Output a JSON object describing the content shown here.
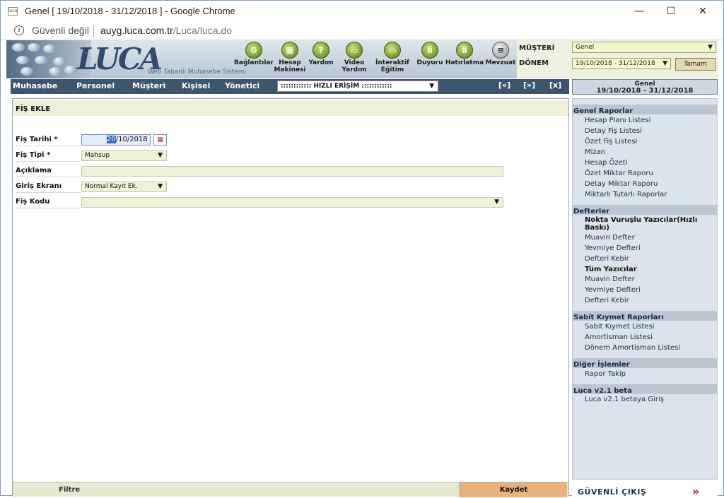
{
  "window": {
    "title": "Genel [ 19/10/2018 - 31/12/2018 ] - Google Chrome",
    "favicon": "luca",
    "minimize": "—",
    "maximize": "☐",
    "close": "✕"
  },
  "address": {
    "security": "Güvenli değil",
    "url_domain": "auyg.luca.com.tr",
    "url_path": "/Luca/luca.do",
    "info_icon": "i"
  },
  "banner": {
    "logo": "LUCA",
    "tagline": "Web Tabanlı Muhasebe Sistemi",
    "tools": [
      {
        "label1": "Bağlantılar",
        "label2": ""
      },
      {
        "label1": "Hesap",
        "label2": "Makinesi"
      },
      {
        "label1": "Yardım",
        "label2": ""
      },
      {
        "label1": "Video",
        "label2": "Yardım"
      },
      {
        "label1": "İnteraktif",
        "label2": "Eğitim"
      },
      {
        "label1": "Duyuru",
        "label2": ""
      },
      {
        "label1": "Hatırlatma",
        "label2": ""
      },
      {
        "label1": "Mevzuat",
        "label2": ""
      }
    ]
  },
  "top": {
    "musteri_label": "MÜŞTERİ",
    "musteri_value": "Genel",
    "donem_label": "DÖNEM",
    "donem_value": "19/10/2018 - 31/12/2018",
    "ok_button": "Tamam"
  },
  "menu": {
    "items": [
      "Muhasebe",
      "Personel",
      "Müşteri",
      "Kişisel",
      "Yönetici"
    ],
    "quick_access": ":::::::::::: HIZLI ERİŞİM ::::::::::::",
    "nav": [
      "[«]",
      "[»]",
      "[x]"
    ]
  },
  "period": {
    "label": "Genel",
    "dates": "19/10/2018 - 31/12/2018"
  },
  "form": {
    "title": "FİŞ EKLE",
    "fis_tarihi_label": "Fiş Tarihi *",
    "date_selected": "20",
    "date_rest": "/10/2018",
    "fis_tipi_label": "Fiş Tipi *",
    "fis_tipi_value": "Mahsup",
    "aciklama_label": "Açıklama",
    "aciklama_value": "",
    "giris_label": "Giriş Ekranı",
    "giris_value": "Normal Kayıt Ek.",
    "fis_kodu_label": "Fiş Kodu",
    "fis_kodu_value": "",
    "filtre": "Filtre",
    "kaydet": "Kaydet"
  },
  "sidebar": {
    "genel_raporlar": {
      "title": "Genel Raporlar",
      "items": [
        "Hesap Planı Listesi",
        "Detay Fiş Listesi",
        "Özet Fiş Listesi",
        "Mizan",
        "Hesap Özeti",
        "Özet Miktar Raporu",
        "Detay Miktar Raporu",
        "Miktarlı Tutarlı Raporlar"
      ]
    },
    "defterler": {
      "title": "Defterler",
      "sub1": "Nokta Vuruşlu Yazıcılar(Hızlı Baskı)",
      "items1": [
        "Muavin Defter",
        "Yevmiye Defteri",
        "Defteri Kebir"
      ],
      "sub2": "Tüm Yazıcılar",
      "items2": [
        "Muavin Defter",
        "Yevmiye Defteri",
        "Defteri Kebir"
      ]
    },
    "sabit": {
      "title": "Sabit Kıymet Raporları",
      "items": [
        "Sabit Kıymet Listesi",
        "Amortisman Listesi",
        "Dönem Amortisman Listesi"
      ]
    },
    "diger": {
      "title": "Diğer İşlemler",
      "items": [
        "Rapor Takip"
      ]
    },
    "luca": {
      "title": "Luca v2.1 beta",
      "items": [
        "Luca v2.1 betaya Giriş"
      ]
    }
  },
  "exit": {
    "label": "GÜVENLİ ÇIKIŞ",
    "arrow": "»"
  }
}
